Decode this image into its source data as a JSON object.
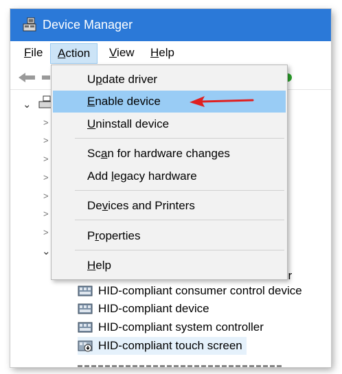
{
  "window": {
    "title": "Device Manager"
  },
  "menubar": {
    "items": [
      {
        "pre": "",
        "u": "F",
        "post": "ile"
      },
      {
        "pre": "",
        "u": "A",
        "post": "ction"
      },
      {
        "pre": "",
        "u": "V",
        "post": "iew"
      },
      {
        "pre": "",
        "u": "H",
        "post": "elp"
      }
    ]
  },
  "action_menu": {
    "items": [
      {
        "pre": "U",
        "u": "p",
        "post": "date driver"
      },
      {
        "pre": "",
        "u": "E",
        "post": "nable device"
      },
      {
        "pre": "",
        "u": "U",
        "post": "ninstall device"
      },
      {
        "pre": "Sc",
        "u": "a",
        "post": "n for hardware changes"
      },
      {
        "pre": "Add ",
        "u": "l",
        "post": "egacy hardware"
      },
      {
        "pre": "De",
        "u": "v",
        "post": "ices and Printers"
      },
      {
        "pre": "P",
        "u": "r",
        "post": "operties"
      },
      {
        "pre": "",
        "u": "H",
        "post": "elp"
      }
    ],
    "highlighted": "Enable device"
  },
  "tree": {
    "partial_row_tail": "er",
    "devices": [
      {
        "label": "HID-compliant consumer control device",
        "icon": "hid-device-icon"
      },
      {
        "label": "HID-compliant device",
        "icon": "hid-device-icon"
      },
      {
        "label": "HID-compliant system controller",
        "icon": "hid-device-icon"
      },
      {
        "label": "HID-compliant touch screen",
        "icon": "hid-disabled-device-icon",
        "selected": true
      }
    ]
  },
  "colors": {
    "titlebar": "#2b79d8",
    "menu_highlight": "#99ccf5",
    "selection": "#e5f1fb",
    "annotation_arrow": "#e02020"
  }
}
